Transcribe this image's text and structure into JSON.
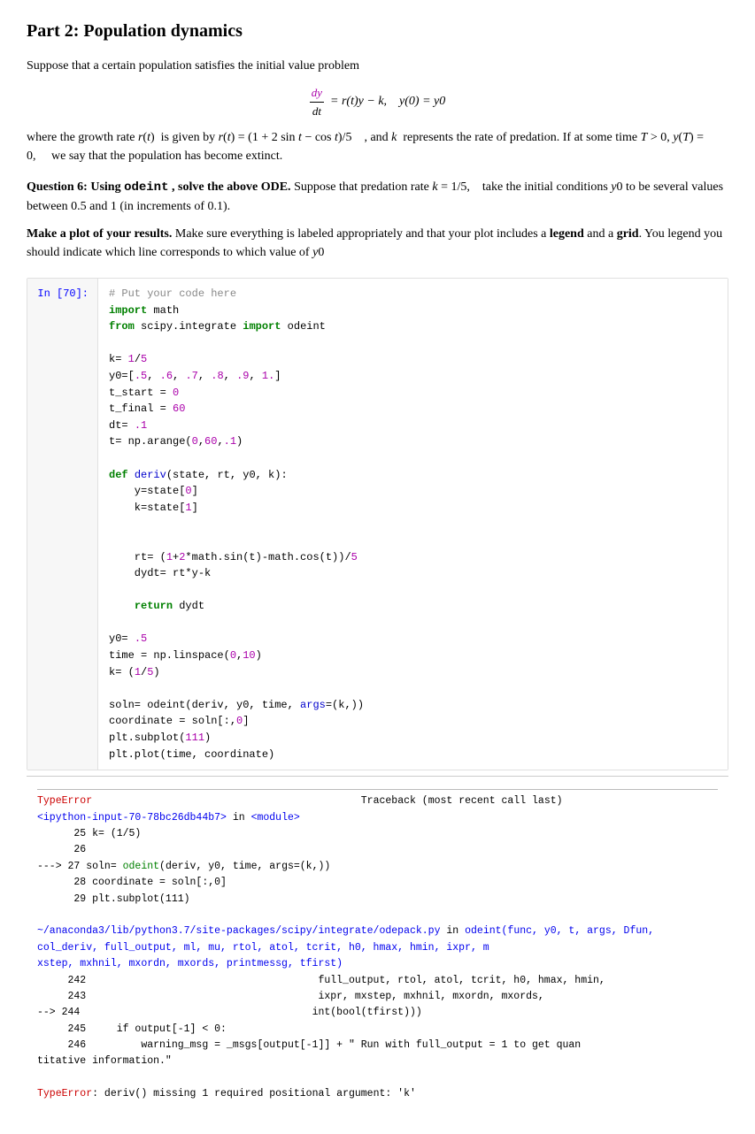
{
  "page": {
    "title": "Part 2: Population dynamics",
    "intro": "Suppose that a certain population satisfies the initial value problem",
    "math_equation": "dy/dt = r(t)y − k,   y(0) = y0",
    "description": "where the growth rate r(t) is given by r(t) = (1 + 2 sin t − cos t)/5, and k represents the rate of predation. If at some time T > 0, y(T) = 0, we say that the population has become extinct.",
    "question6_label": "Question 6:",
    "question6_intro": "Using odeint , solve the above ODE.",
    "question6_body": "Suppose that predation rate k = 1/5, take the initial conditions y0 to be several values between 0.5 and 1 (in increments of 0.1).",
    "make_plot_label": "Make a plot of your results.",
    "make_plot_body": "Make sure everything is labeled appropriately and that your plot includes a legend and a grid. You legend you should indicate which line corresponds to which value of y0",
    "cell_label": "In [70]:",
    "code_comment": "# Put your code here",
    "code_lines": [
      "import math",
      "from scipy.integrate import odeint",
      "",
      "k= 1/5",
      "y0=[.5, .6, .7, .8, .9, 1.]",
      "t_start = 0",
      "t_final = 60",
      "dt= .1",
      "t= np.arange(0,60,.1)",
      "",
      "def deriv(state, rt, y0, k):",
      "    y=state[0]",
      "    k=state[1]",
      "",
      "",
      "    rt= (1+2*math.sin(t)-math.cos(t))/5",
      "    dydt= rt*y-k",
      "",
      "    return dydt",
      "",
      "y0= .5",
      "time = np.linspace(0,10)",
      "k= (1/5)",
      "",
      "soln= odeint(deriv, y0, time, args=(k,))",
      "coordinate = soln[:,0]",
      "plt.subplot(111)",
      "plt.plot(time, coordinate)"
    ],
    "error_separator": "--------------------------------------------------------------------",
    "error_type": "TypeError",
    "traceback_label": "Traceback (most recent call last)",
    "error_file": "<ipython-input-70-78bc26db44b7>",
    "error_module": "<module>",
    "error_lines": [
      "25 k= (1/5)",
      "26",
      "---> 27 soln= odeint(deriv, y0, time, args=(k,))",
      "28 coordinate = soln[:,0]",
      "29 plt.subplot(111)"
    ],
    "scipy_path": "~/anaconda3/lib/python3.7/site-packages/scipy/integrate/odepack.py",
    "scipy_in": "odeint(func, y0, t, args, Dfun, col_deriv, full_output, ml, mu, rtol, atol, tcrit, h0, hmax, hmin, ixpr, mxstep, mxhnil, mxordn, mxords, printmessg, tfirst)",
    "scipy_lines": [
      "242          full_output, rtol, atol, tcrit, h0, hmax, hmin,",
      "243          ixpr, mxstep, mxhnil, mxordn, mxords,",
      "--> 244          int(bool(tfirst)))",
      "245  if output[-1] < 0:",
      "246      warning_msg = _msgs[output[-1]] + \" Run with full_output = 1 to get quan"
    ],
    "titative": "titative information.\"",
    "final_error": "TypeError: deriv() missing 1 required positional argument: 'k'"
  }
}
